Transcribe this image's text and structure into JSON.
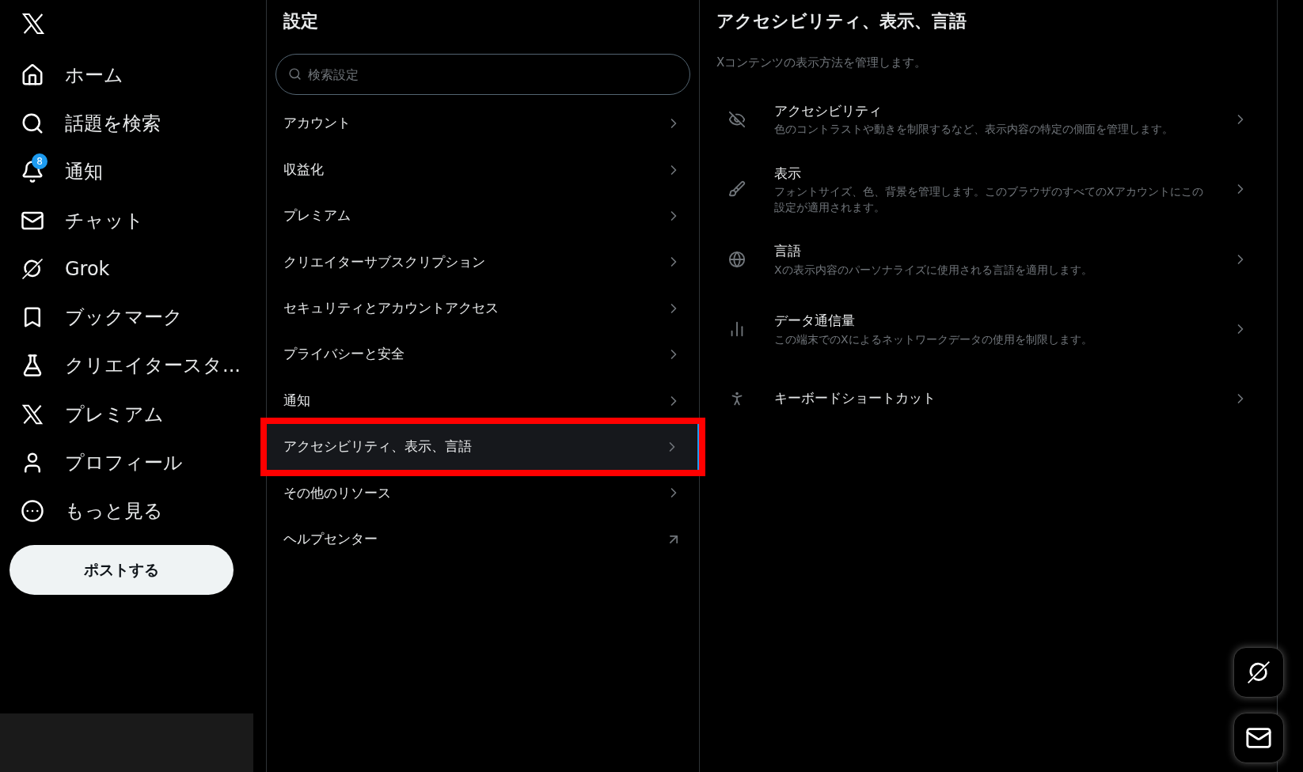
{
  "sidebar": {
    "items": [
      {
        "label": "ホーム"
      },
      {
        "label": "話題を検索"
      },
      {
        "label": "通知",
        "badge": "8"
      },
      {
        "label": "チャット"
      },
      {
        "label": "Grok"
      },
      {
        "label": "ブックマーク"
      },
      {
        "label": "クリエイタースタ..."
      },
      {
        "label": "プレミアム"
      },
      {
        "label": "プロフィール"
      },
      {
        "label": "もっと見る"
      }
    ],
    "post_button": "ポストする"
  },
  "settings": {
    "title": "設定",
    "search": {
      "placeholder": "検索設定"
    },
    "items": [
      {
        "label": "アカウント",
        "kind": "chevron",
        "selected": false
      },
      {
        "label": "収益化",
        "kind": "chevron",
        "selected": false
      },
      {
        "label": "プレミアム",
        "kind": "chevron",
        "selected": false
      },
      {
        "label": "クリエイターサブスクリプション",
        "kind": "chevron",
        "selected": false
      },
      {
        "label": "セキュリティとアカウントアクセス",
        "kind": "chevron",
        "selected": false
      },
      {
        "label": "プライバシーと安全",
        "kind": "chevron",
        "selected": false
      },
      {
        "label": "通知",
        "kind": "chevron",
        "selected": false
      },
      {
        "label": "アクセシビリティ、表示、言語",
        "kind": "chevron",
        "selected": true
      },
      {
        "label": "その他のリソース",
        "kind": "chevron",
        "selected": false
      },
      {
        "label": "ヘルプセンター",
        "kind": "external",
        "selected": false
      }
    ]
  },
  "detail": {
    "title": "アクセシビリティ、表示、言語",
    "description": "Xコンテンツの表示方法を管理します。",
    "items": [
      {
        "title": "アクセシビリティ",
        "description": "色のコントラストや動きを制限するなど、表示内容の特定の側面を管理します。"
      },
      {
        "title": "表示",
        "description": "フォントサイズ、色、背景を管理します。このブラウザのすべてのXアカウントにこの設定が適用されます。"
      },
      {
        "title": "言語",
        "description": "Xの表示内容のパーソナライズに使用される言語を適用します。"
      },
      {
        "title": "データ通信量",
        "description": "この端末でのXによるネットワークデータの使用を制限します。"
      },
      {
        "title": "キーボードショートカット"
      }
    ]
  }
}
